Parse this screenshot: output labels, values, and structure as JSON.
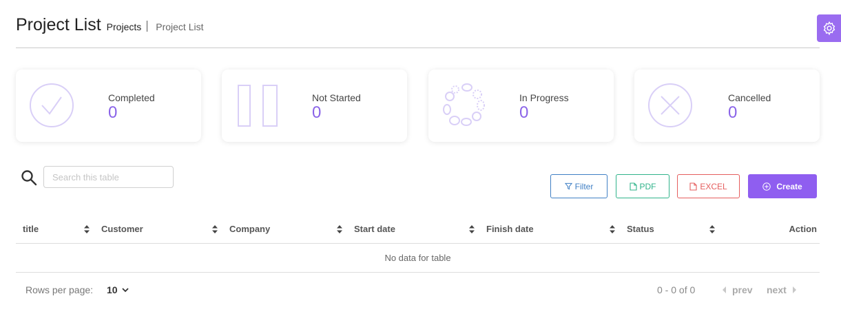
{
  "header": {
    "title": "Project List",
    "breadcrumb_active": "Projects",
    "breadcrumb_current": "Project List"
  },
  "cards": [
    {
      "label": "Completed",
      "value": "0",
      "icon": "check-circle-icon"
    },
    {
      "label": "Not Started",
      "value": "0",
      "icon": "pause-icon"
    },
    {
      "label": "In Progress",
      "value": "0",
      "icon": "spinner-icon"
    },
    {
      "label": "Cancelled",
      "value": "0",
      "icon": "x-circle-icon"
    }
  ],
  "search": {
    "placeholder": "Search this table"
  },
  "toolbar": {
    "filter_label": "Filter",
    "pdf_label": "PDF",
    "excel_label": "EXCEL",
    "create_label": "Create"
  },
  "table": {
    "columns": [
      "title",
      "Customer",
      "Company",
      "Start date",
      "Finish date",
      "Status",
      "Action"
    ],
    "empty_text": "No data for table"
  },
  "pagination": {
    "rows_per_page_label": "Rows per page:",
    "rows_per_page_value": "10",
    "range_text": "0 - 0 of 0",
    "prev_label": "prev",
    "next_label": "next"
  },
  "colors": {
    "accent": "#8f5ef0",
    "filter": "#3f7fc4",
    "pdf": "#2fb38a",
    "excel": "#e55d5d"
  }
}
